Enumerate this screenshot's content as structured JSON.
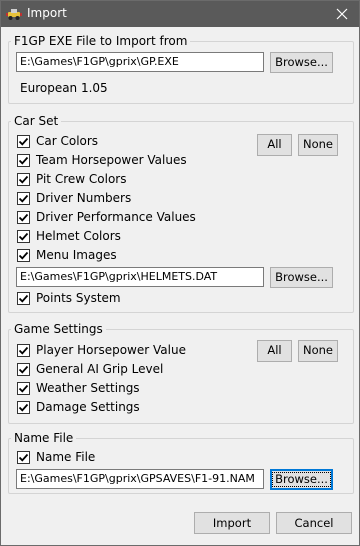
{
  "window": {
    "title": "Import",
    "app_icon": "car-icon"
  },
  "exe_group": {
    "legend": "F1GP EXE File to Import from",
    "path": "E:\\Games\\F1GP\\gprix\\GP.EXE",
    "browse_label": "Browse...",
    "version": "European 1.05"
  },
  "car_set": {
    "legend": "Car Set",
    "all_label": "All",
    "none_label": "None",
    "items": [
      {
        "label": "Car Colors",
        "checked": true
      },
      {
        "label": "Team Horsepower Values",
        "checked": true
      },
      {
        "label": "Pit Crew Colors",
        "checked": true
      },
      {
        "label": "Driver Numbers",
        "checked": true
      },
      {
        "label": "Driver Performance Values",
        "checked": true
      },
      {
        "label": "Helmet Colors",
        "checked": true
      },
      {
        "label": "Menu Images",
        "checked": true
      }
    ],
    "helmets_path": "E:\\Games\\F1GP\\gprix\\HELMETS.DAT",
    "helmets_browse_label": "Browse...",
    "points_label": "Points System",
    "points_checked": true
  },
  "game_settings": {
    "legend": "Game Settings",
    "all_label": "All",
    "none_label": "None",
    "items": [
      {
        "label": "Player Horsepower Value",
        "checked": true
      },
      {
        "label": "General AI Grip Level",
        "checked": true
      },
      {
        "label": "Weather Settings",
        "checked": true
      },
      {
        "label": "Damage Settings",
        "checked": true
      }
    ]
  },
  "name_file": {
    "legend": "Name File",
    "checkbox_label": "Name File",
    "checked": true,
    "path": "E:\\Games\\F1GP\\gprix\\GPSAVES\\F1-91.NAM",
    "browse_label": "Browse..."
  },
  "footer": {
    "import_label": "Import",
    "cancel_label": "Cancel"
  }
}
